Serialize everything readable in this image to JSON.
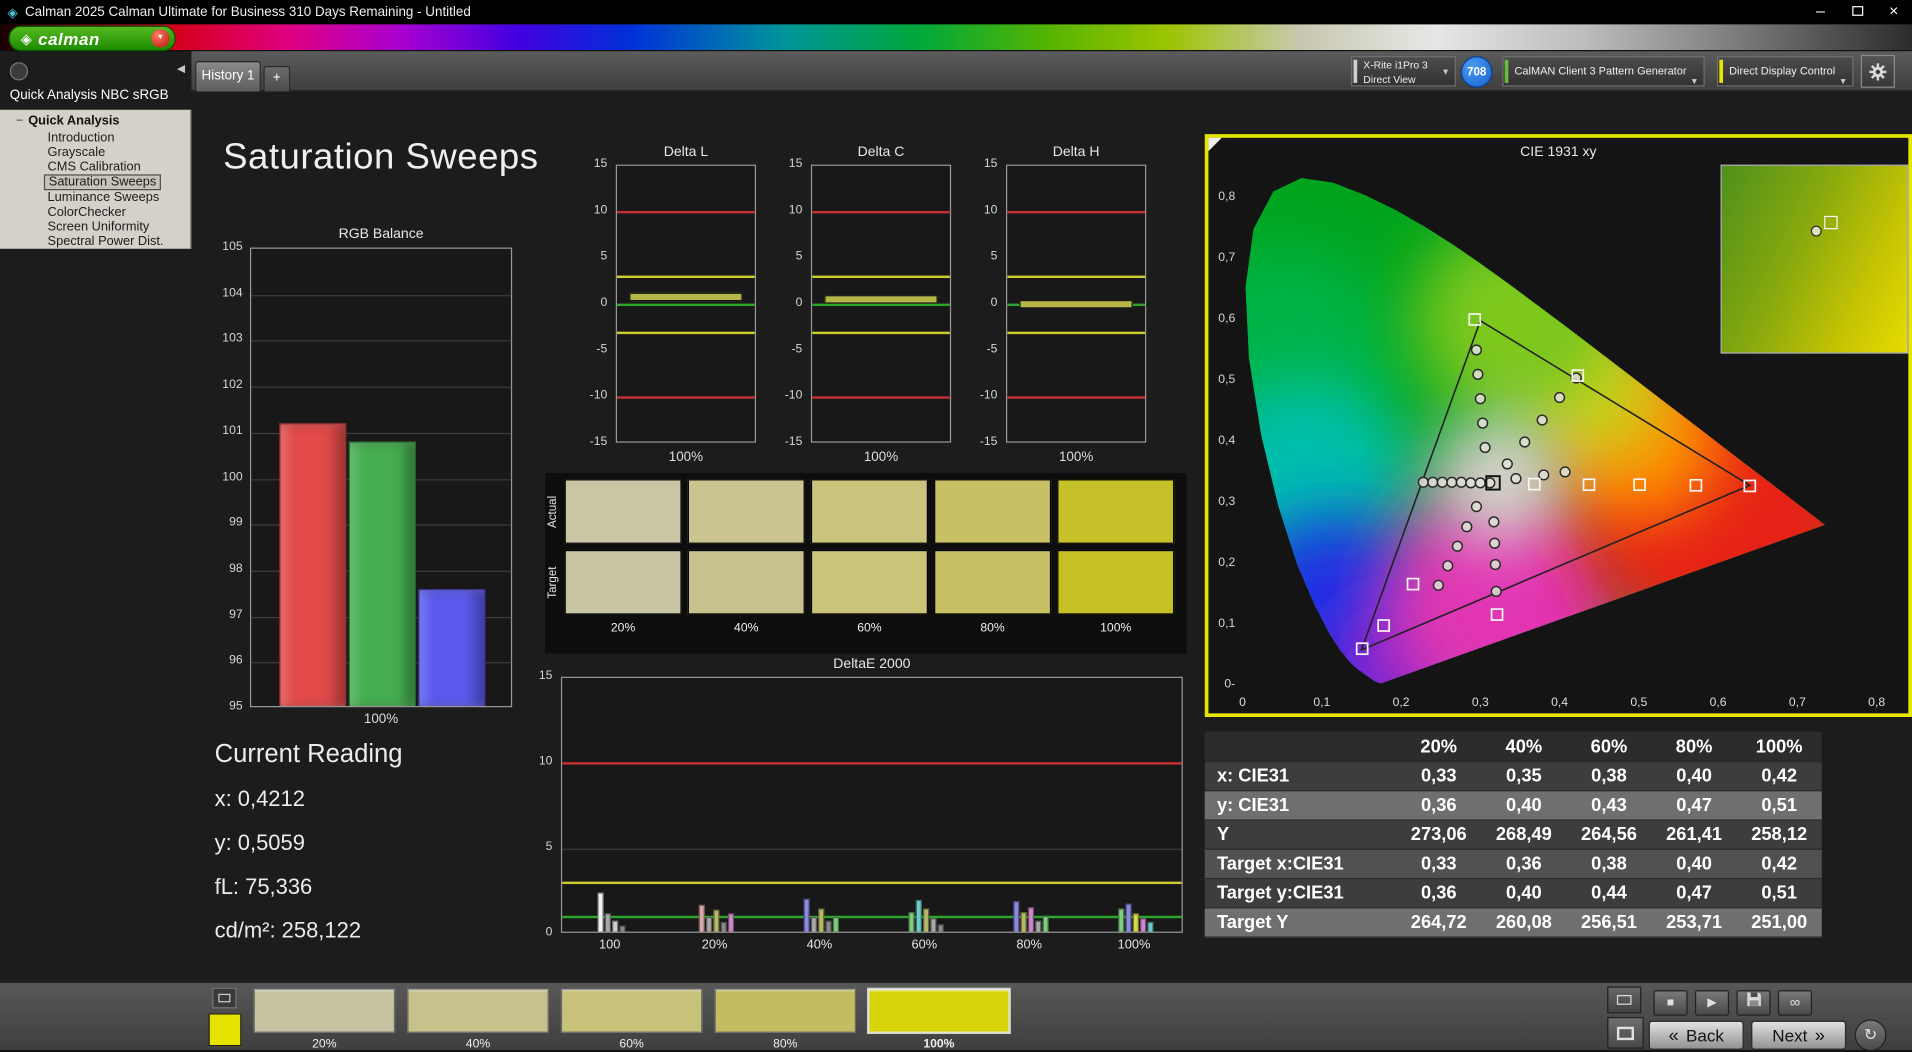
{
  "window": {
    "title": "Calman 2025 Calman Ultimate for Business 310 Days Remaining  - Untitled"
  },
  "brand": {
    "name": "calman"
  },
  "tabs": {
    "history": "History 1",
    "add": "+"
  },
  "devices": {
    "meter_line1": "X-Rite i1Pro 3",
    "meter_line2": "Direct View",
    "meter_badge": "708",
    "pattern": "CalMAN Client 3 Pattern Generator",
    "display": "Direct Display Control"
  },
  "sidebar": {
    "header": "Quick Analysis NBC sRGB",
    "root": "Quick Analysis",
    "items": [
      "Introduction",
      "Grayscale",
      "CMS Calibration",
      "Saturation Sweeps",
      "Luminance Sweeps",
      "ColorChecker",
      "Screen Uniformity",
      "Spectral Power Dist."
    ],
    "selected_index": 3
  },
  "page": {
    "title": "Saturation Sweeps"
  },
  "current_reading": {
    "title": "Current Reading",
    "lines": [
      "x: 0,4212",
      "y: 0,5059",
      "fL: 75,336",
      "cd/m²: 258,122"
    ]
  },
  "status_colors": {
    "error": "#c53030",
    "warn": "#cdcd30",
    "ok": "#2da52d"
  },
  "accents": {
    "cie_border": "#e6e600",
    "pattern_strip": "#67bd3a",
    "display_strip": "#e6e600",
    "meter_strip": "#cfcfcf",
    "badge_bg": "#1464d2",
    "current_pattern": "#e8e200"
  },
  "chart_data": [
    {
      "type": "bar",
      "title": "RGB Balance",
      "xlabel": "100%",
      "categories": [
        "Red",
        "Green",
        "Blue"
      ],
      "values": [
        101.2,
        100.8,
        97.6
      ],
      "colors": [
        "#e34a4a",
        "#46ae50",
        "#5a5aee"
      ],
      "ylim": [
        95,
        105
      ],
      "ytick_step": 1
    },
    {
      "type": "bar",
      "title": "Delta L",
      "xlabel": "100%",
      "value": 0.8,
      "ylim": [
        -15,
        15
      ],
      "yticks": [
        15,
        10,
        5,
        0,
        -5,
        -10,
        -15
      ],
      "limit_red": 10,
      "limit_yellow": 3,
      "limit_green": 0,
      "bar_color": "#b6b648"
    },
    {
      "type": "bar",
      "title": "Delta C",
      "xlabel": "100%",
      "value": 0.6,
      "ylim": [
        -15,
        15
      ],
      "yticks": [
        15,
        10,
        5,
        0,
        -5,
        -10,
        -15
      ],
      "limit_red": 10,
      "limit_yellow": 3,
      "limit_green": 0,
      "bar_color": "#b6b648"
    },
    {
      "type": "bar",
      "title": "Delta H",
      "xlabel": "100%",
      "value": 0.1,
      "ylim": [
        -15,
        15
      ],
      "yticks": [
        15,
        10,
        5,
        0,
        -5,
        -10,
        -15
      ],
      "limit_red": 10,
      "limit_yellow": 3,
      "limit_green": 0,
      "bar_color": "#b6b648"
    },
    {
      "type": "bar",
      "title": "DeltaE 2000",
      "ylim": [
        0,
        15
      ],
      "yticks": [
        15,
        10,
        5,
        0
      ],
      "limit_red": 10,
      "limit_yellow": 3,
      "limit_green": 1,
      "categories": [
        "100",
        "20%",
        "40%",
        "60%",
        "80%",
        "100%"
      ],
      "clusters": [
        [
          {
            "v": 2.4,
            "c": "#f2f2f2"
          },
          {
            "v": 1.2,
            "c": "#a8a8a8"
          },
          {
            "v": 0.8,
            "c": "#cfcfcf"
          },
          {
            "v": 0.5,
            "c": "#8a8a8a"
          }
        ],
        [
          {
            "v": 1.7,
            "c": "#d8a8a8"
          },
          {
            "v": 1.0,
            "c": "#a8a8a8"
          },
          {
            "v": 1.4,
            "c": "#b8b868"
          },
          {
            "v": 0.7,
            "c": "#8a8a8a"
          },
          {
            "v": 1.2,
            "c": "#cc88cc"
          }
        ],
        [
          {
            "v": 2.1,
            "c": "#8a8ae0"
          },
          {
            "v": 1.0,
            "c": "#a8a8a8"
          },
          {
            "v": 1.5,
            "c": "#b8b868"
          },
          {
            "v": 0.8,
            "c": "#8a8a8a"
          },
          {
            "v": 1.0,
            "c": "#7ecc7e"
          }
        ],
        [
          {
            "v": 1.3,
            "c": "#7ecc7e"
          },
          {
            "v": 2.0,
            "c": "#6eccc8"
          },
          {
            "v": 1.5,
            "c": "#b8b868"
          },
          {
            "v": 0.9,
            "c": "#a8a8a8"
          },
          {
            "v": 0.6,
            "c": "#8a8a8a"
          }
        ],
        [
          {
            "v": 1.9,
            "c": "#8a8ae0"
          },
          {
            "v": 1.3,
            "c": "#b8b868"
          },
          {
            "v": 1.6,
            "c": "#cc88cc"
          },
          {
            "v": 0.8,
            "c": "#a8a8a8"
          },
          {
            "v": 1.1,
            "c": "#7ecc7e"
          }
        ],
        [
          {
            "v": 1.5,
            "c": "#7ecc7e"
          },
          {
            "v": 1.8,
            "c": "#8a8ae0"
          },
          {
            "v": 1.2,
            "c": "#d8d84a"
          },
          {
            "v": 0.9,
            "c": "#cc88cc"
          },
          {
            "v": 0.7,
            "c": "#6eccc8"
          }
        ]
      ]
    },
    {
      "type": "scatter",
      "title": "CIE 1931 xy",
      "xlim": [
        0,
        0.8
      ],
      "ylim": [
        0,
        0.9
      ],
      "xtick_labels": [
        "0",
        "0,1",
        "0,2",
        "0,3",
        "0,4",
        "0,5",
        "0,6",
        "0,7",
        "0,8"
      ],
      "ytick_labels": [
        "0,8",
        "0,7",
        "0,6",
        "0,5",
        "0,4",
        "0,3",
        "0,2",
        "0,1",
        "0-"
      ],
      "triangle": [
        [
          0.64,
          0.33
        ],
        [
          0.3,
          0.6
        ],
        [
          0.15,
          0.06
        ]
      ],
      "white_point": [
        0.313,
        0.329
      ],
      "cursor": [
        0.316,
        0.334
      ],
      "targets": [
        [
          0.368,
          0.332
        ],
        [
          0.437,
          0.331
        ],
        [
          0.501,
          0.331
        ],
        [
          0.572,
          0.33
        ],
        [
          0.64,
          0.329
        ],
        [
          0.293,
          0.602
        ],
        [
          0.215,
          0.168
        ],
        [
          0.178,
          0.1
        ],
        [
          0.151,
          0.062
        ],
        [
          0.423,
          0.51
        ],
        [
          0.321,
          0.118
        ]
      ],
      "measured": [
        [
          0.228,
          0.335
        ],
        [
          0.24,
          0.335
        ],
        [
          0.252,
          0.335
        ],
        [
          0.264,
          0.335
        ],
        [
          0.276,
          0.335
        ],
        [
          0.288,
          0.334
        ],
        [
          0.3,
          0.334
        ],
        [
          0.312,
          0.334
        ],
        [
          0.306,
          0.392
        ],
        [
          0.303,
          0.432
        ],
        [
          0.3,
          0.472
        ],
        [
          0.297,
          0.512
        ],
        [
          0.295,
          0.552
        ],
        [
          0.334,
          0.365
        ],
        [
          0.356,
          0.401
        ],
        [
          0.378,
          0.437
        ],
        [
          0.4,
          0.474
        ],
        [
          0.421,
          0.506
        ],
        [
          0.295,
          0.295
        ],
        [
          0.283,
          0.262
        ],
        [
          0.271,
          0.23
        ],
        [
          0.259,
          0.198
        ],
        [
          0.247,
          0.166
        ],
        [
          0.317,
          0.27
        ],
        [
          0.318,
          0.235
        ],
        [
          0.319,
          0.2
        ],
        [
          0.32,
          0.156
        ],
        [
          0.345,
          0.341
        ],
        [
          0.38,
          0.347
        ],
        [
          0.407,
          0.352
        ]
      ]
    }
  ],
  "patches": {
    "rows": [
      "Actual",
      "Target"
    ],
    "cols": [
      "20%",
      "40%",
      "60%",
      "80%",
      "100%"
    ],
    "actual": [
      "#c9c6a6",
      "#c9c490",
      "#cbc47c",
      "#c8c065",
      "#c6c128"
    ],
    "target": [
      "#c8c5a4",
      "#c8c38e",
      "#cac37a",
      "#c7bf63",
      "#c5c024"
    ]
  },
  "table": {
    "col_headers": [
      "20%",
      "40%",
      "60%",
      "80%",
      "100%"
    ],
    "rows": [
      {
        "label": "x: CIE31",
        "values": [
          "0,33",
          "0,35",
          "0,38",
          "0,40",
          "0,42"
        ]
      },
      {
        "label": "y: CIE31",
        "values": [
          "0,36",
          "0,40",
          "0,43",
          "0,47",
          "0,51"
        ]
      },
      {
        "label": "Y",
        "values": [
          "273,06",
          "268,49",
          "264,56",
          "261,41",
          "258,12"
        ]
      },
      {
        "label": "Target x:CIE31",
        "values": [
          "0,33",
          "0,36",
          "0,38",
          "0,40",
          "0,42"
        ]
      },
      {
        "label": "Target y:CIE31",
        "values": [
          "0,36",
          "0,40",
          "0,44",
          "0,47",
          "0,51"
        ]
      },
      {
        "label": "Target Y",
        "values": [
          "264,72",
          "260,08",
          "256,51",
          "253,71",
          "251,00"
        ]
      }
    ]
  },
  "bottom": {
    "back_arrow": "«",
    "back": "Back",
    "next": "Next",
    "next_arrow": "»",
    "swatches": [
      {
        "label": "20%",
        "color": "#c6c2a2"
      },
      {
        "label": "40%",
        "color": "#c7c28c"
      },
      {
        "label": "60%",
        "color": "#c8c179"
      },
      {
        "label": "80%",
        "color": "#c4bc60"
      },
      {
        "label": "100%",
        "color": "#d6d408",
        "selected": true
      }
    ]
  }
}
